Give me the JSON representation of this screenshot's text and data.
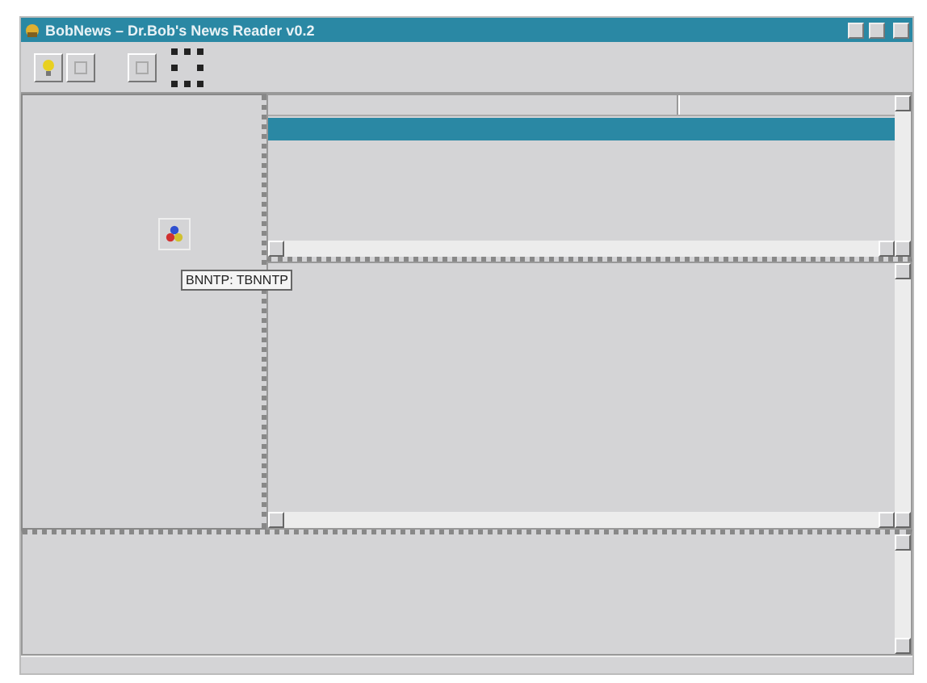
{
  "window": {
    "title": "BobNews – Dr.Bob's News Reader v0.2"
  },
  "designer": {
    "component_hint": "BNNTP: TBNNTP"
  },
  "article_list": {
    "rows": [
      {
        "selected": true
      }
    ]
  }
}
